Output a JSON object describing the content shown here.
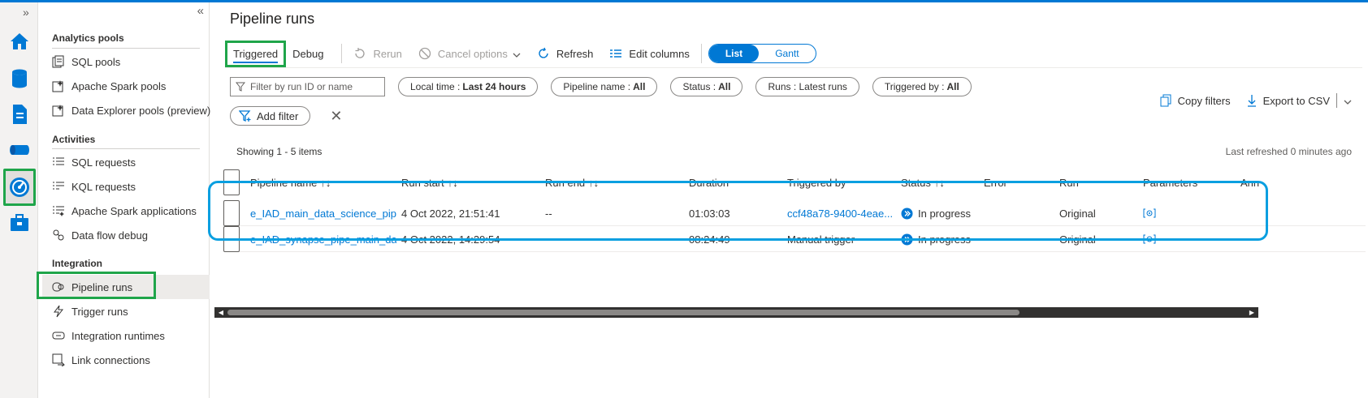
{
  "page": {
    "title": "Pipeline runs"
  },
  "nav": {
    "sections": [
      {
        "title": "Analytics pools",
        "items": [
          "SQL pools",
          "Apache Spark pools",
          "Data Explorer pools (preview)"
        ]
      },
      {
        "title": "Activities",
        "items": [
          "SQL requests",
          "KQL requests",
          "Apache Spark applications",
          "Data flow debug"
        ]
      },
      {
        "title": "Integration",
        "items": [
          "Pipeline runs",
          "Trigger runs",
          "Integration runtimes",
          "Link connections"
        ]
      }
    ]
  },
  "tabs": {
    "triggered": "Triggered",
    "debug": "Debug"
  },
  "toolbar": {
    "rerun": "Rerun",
    "cancel": "Cancel options",
    "refresh": "Refresh",
    "edit_columns": "Edit columns",
    "view_list": "List",
    "view_gantt": "Gantt"
  },
  "filters": {
    "search_placeholder": "Filter by run ID or name",
    "local_time_label": "Local time :",
    "local_time_value": "Last 24 hours",
    "pipeline_name_label": "Pipeline name :",
    "pipeline_name_value": "All",
    "status_label": "Status :",
    "status_value": "All",
    "runs_label": "Runs : Latest runs",
    "triggered_by_label": "Triggered by :",
    "triggered_by_value": "All",
    "add_filter": "Add filter",
    "copy_filters": "Copy filters",
    "export_csv": "Export to CSV"
  },
  "grid": {
    "showing": "Showing 1 - 5 items",
    "last_refreshed": "Last refreshed 0 minutes ago",
    "columns": {
      "pipeline_name": "Pipeline name",
      "run_start": "Run start",
      "run_end": "Run end",
      "duration": "Duration",
      "triggered_by": "Triggered by",
      "status": "Status",
      "error": "Error",
      "run": "Run",
      "parameters": "Parameters",
      "annotations": "Ann"
    },
    "rows": [
      {
        "pipeline_name": "e_IAD_main_data_science_pipe",
        "run_start": "4 Oct 2022, 21:51:41",
        "run_end": "--",
        "duration": "01:03:03",
        "triggered_by": "ccf48a78-9400-4eae...",
        "status": "In progress",
        "run": "Original"
      },
      {
        "pipeline_name": "e_IAD_synapse_pipe_main_da...",
        "run_start": "4 Oct 2022, 14:29:54",
        "run_end": "--",
        "duration": "08:24:49",
        "triggered_by": "Manual trigger",
        "status": "In progress",
        "run": "Original"
      }
    ]
  },
  "colors": {
    "accent": "#0078d4",
    "highlight_green": "#1fa54a",
    "highlight_blue": "#0a9fe0"
  }
}
